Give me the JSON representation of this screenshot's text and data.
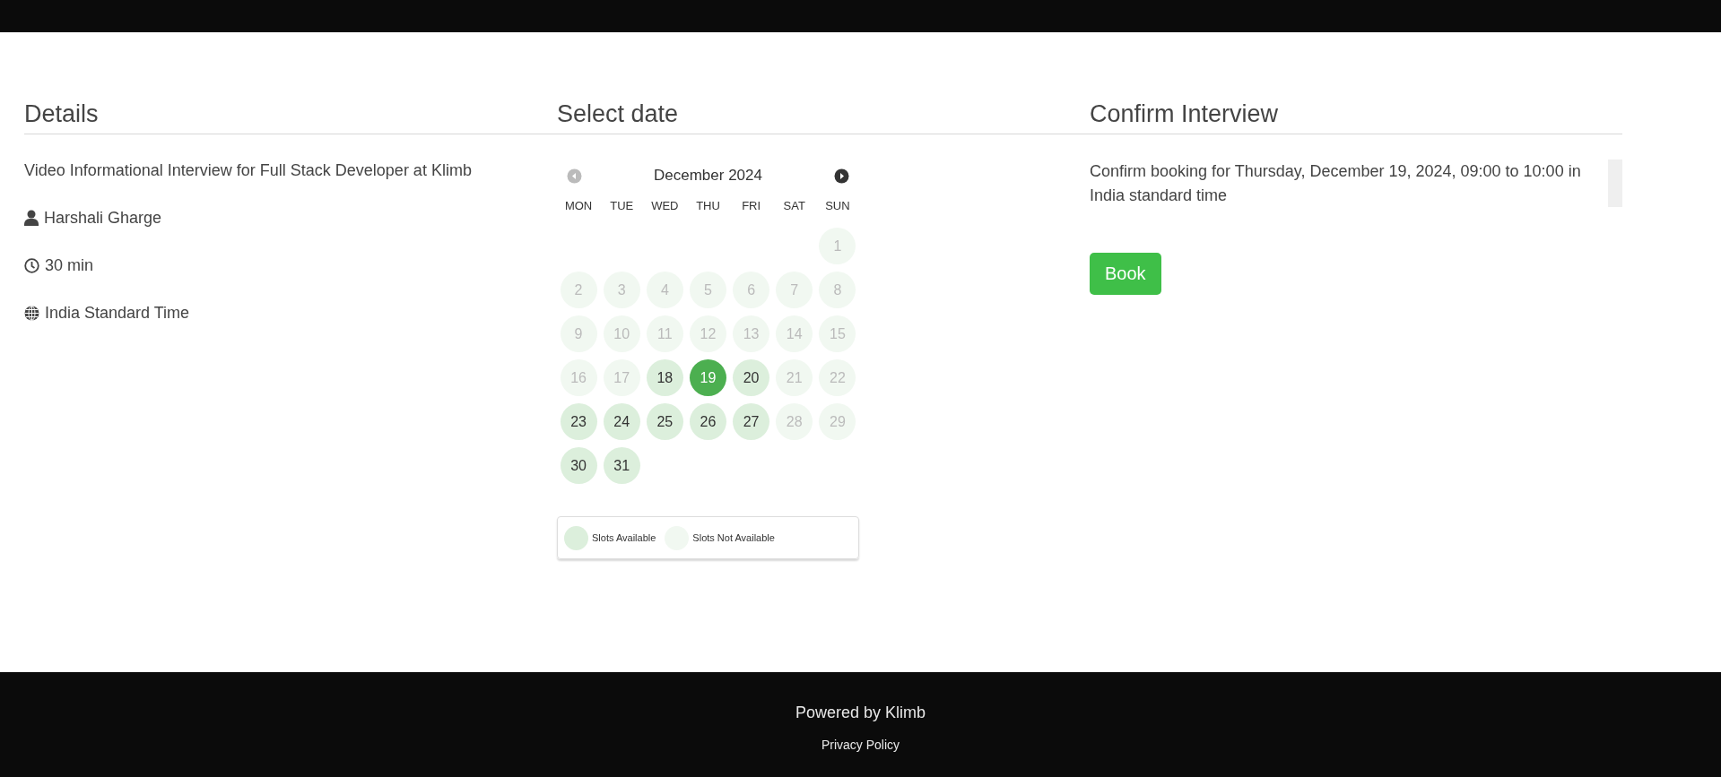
{
  "details": {
    "title": "Details",
    "interview": "Video Informational Interview for Full Stack Developer at Klimb",
    "items": [
      {
        "kind": "person",
        "text": "Harshali Gharge"
      },
      {
        "kind": "duration",
        "text": "30 min"
      },
      {
        "kind": "timezone",
        "text": "India Standard Time"
      }
    ]
  },
  "calendar": {
    "title": "Select date",
    "month": "December 2024",
    "prev_disabled": true,
    "next_disabled": false,
    "weekdays": [
      "MON",
      "TUE",
      "WED",
      "THU",
      "FRI",
      "SAT",
      "SUN"
    ],
    "weeks": [
      [
        {
          "day": "1",
          "available": false,
          "selected": false
        }
      ],
      [
        {
          "day": "2",
          "available": false,
          "selected": false
        },
        {
          "day": "3",
          "available": false,
          "selected": false
        },
        {
          "day": "4",
          "available": false,
          "selected": false
        },
        {
          "day": "5",
          "available": false,
          "selected": false
        },
        {
          "day": "6",
          "available": false,
          "selected": false
        },
        {
          "day": "7",
          "available": false,
          "selected": false
        },
        {
          "day": "8",
          "available": false,
          "selected": false
        }
      ],
      [
        {
          "day": "9",
          "available": false,
          "selected": false
        },
        {
          "day": "10",
          "available": false,
          "selected": false
        },
        {
          "day": "11",
          "available": false,
          "selected": false
        },
        {
          "day": "12",
          "available": false,
          "selected": false
        },
        {
          "day": "13",
          "available": false,
          "selected": false
        },
        {
          "day": "14",
          "available": false,
          "selected": false
        },
        {
          "day": "15",
          "available": false,
          "selected": false
        }
      ],
      [
        {
          "day": "16",
          "available": false,
          "selected": false
        },
        {
          "day": "17",
          "available": false,
          "selected": false
        },
        {
          "day": "18",
          "available": true,
          "selected": false
        },
        {
          "day": "19",
          "available": true,
          "selected": true
        },
        {
          "day": "20",
          "available": true,
          "selected": false
        },
        {
          "day": "21",
          "available": false,
          "selected": false
        },
        {
          "day": "22",
          "available": false,
          "selected": false
        }
      ],
      [
        {
          "day": "23",
          "available": true,
          "selected": false
        },
        {
          "day": "24",
          "available": true,
          "selected": false
        },
        {
          "day": "25",
          "available": true,
          "selected": false
        },
        {
          "day": "26",
          "available": true,
          "selected": false
        },
        {
          "day": "27",
          "available": true,
          "selected": false
        },
        {
          "day": "28",
          "available": false,
          "selected": false
        },
        {
          "day": "29",
          "available": false,
          "selected": false
        }
      ],
      [
        {
          "day": "30",
          "available": true,
          "selected": false
        },
        {
          "day": "31",
          "available": true,
          "selected": false
        }
      ]
    ],
    "legend": [
      {
        "label": "Slots Available",
        "available": true
      },
      {
        "label": "Slots Not Available",
        "available": false
      }
    ]
  },
  "confirm": {
    "title": "Confirm Interview",
    "message": "Confirm booking for Thursday, December 19, 2024, 09:00 to 10:00 in India standard time",
    "button": "Book"
  },
  "footer": {
    "powered_by": "Powered by Klimb",
    "link": "Privacy Policy"
  }
}
